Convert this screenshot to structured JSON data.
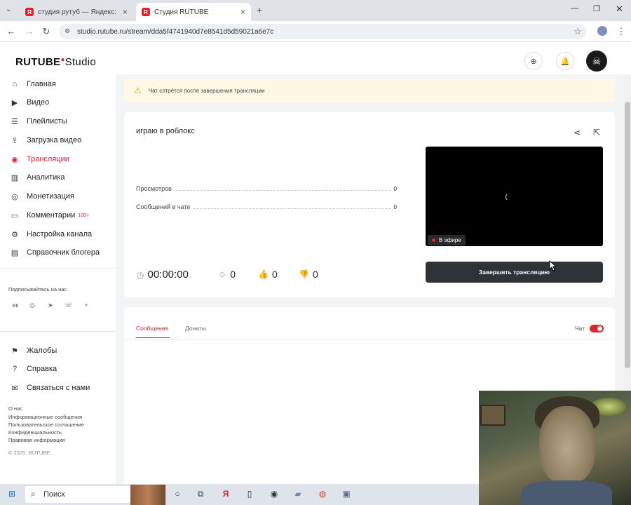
{
  "browser": {
    "tabs": [
      {
        "title": "студия рутуб — Яндекс: нашл…",
        "icon": "yandex-icon"
      },
      {
        "title": "Студия RUTUBE",
        "icon": "rutube-icon"
      }
    ],
    "new_tab": "+",
    "url": "studio.rutube.ru/stream/dda5f4741940d7e8541d5d59021a6e7c"
  },
  "app": {
    "logo_main": "RUTUBE",
    "logo_suffix": "Studio",
    "brand_color": "#e4202e"
  },
  "sidebar": {
    "items": [
      {
        "label": "Главная",
        "icon": "home-icon"
      },
      {
        "label": "Видео",
        "icon": "play-icon"
      },
      {
        "label": "Плейлисты",
        "icon": "list-icon"
      },
      {
        "label": "Загрузка видео",
        "icon": "upload-icon"
      },
      {
        "label": "Трансляции",
        "icon": "broadcast-icon",
        "active": true
      },
      {
        "label": "Аналитика",
        "icon": "chart-icon"
      },
      {
        "label": "Монетизация",
        "icon": "money-icon"
      },
      {
        "label": "Комментарии",
        "icon": "comment-icon",
        "badge": "100+"
      },
      {
        "label": "Настройка канала",
        "icon": "gear-icon"
      },
      {
        "label": "Справочник блогера",
        "icon": "book-icon"
      }
    ],
    "follow_title": "Подписывайтесь на нас",
    "bottom_items": [
      {
        "label": "Жалобы",
        "icon": "flag-icon"
      },
      {
        "label": "Справка",
        "icon": "help-icon"
      },
      {
        "label": "Связаться с нами",
        "icon": "mail-icon"
      }
    ],
    "footer_links": [
      "О нас",
      "Информационные сообщения",
      "Пользовательское соглашение",
      "Конфиденциальность",
      "Правовая информация"
    ],
    "copyright": "© 2025, RUTUBE"
  },
  "notice": {
    "text": "Чат сотрётся после завершения трансляции"
  },
  "stream": {
    "title": "играю в роблокс",
    "stats": [
      {
        "label": "Просмотров",
        "value": "0"
      },
      {
        "label": "Сообщений в чате",
        "value": "0"
      }
    ],
    "live_label": "В эфире",
    "end_button": "Завершить трансляцию",
    "timer": "00:00:00",
    "viewers": "0",
    "likes": "0",
    "dislikes": "0"
  },
  "chat": {
    "tabs": [
      "Сообщения",
      "Донаты"
    ],
    "active_tab": 0,
    "toggle_label": "Чат",
    "toggle_on": true
  },
  "taskbar": {
    "search_label": "Поиск"
  }
}
